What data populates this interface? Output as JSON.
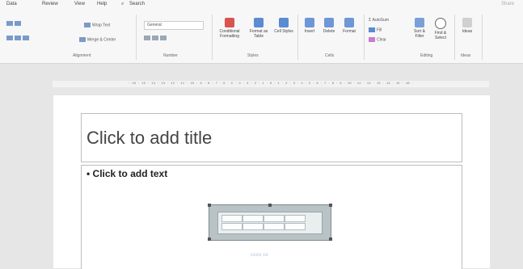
{
  "menubar": {
    "items": [
      "Data",
      "Review",
      "View",
      "Help",
      "Search"
    ],
    "share_label": "Share"
  },
  "ribbon": {
    "alignment": {
      "wrap_text": "Wrap Text",
      "merge_center": "Merge & Center",
      "label": "Alignment"
    },
    "number": {
      "format_value": "General",
      "label": "Number"
    },
    "styles": {
      "conditional_formatting": "Conditional Formatting",
      "format_as_table": "Format as Table",
      "cell_styles": "Cell Styles",
      "label": "Styles"
    },
    "cells": {
      "insert": "Insert",
      "delete": "Delete",
      "format": "Format",
      "label": "Cells"
    },
    "editing": {
      "autosum": "AutoSum",
      "fill": "Fill",
      "clear": "Clear",
      "sort_filter": "Sort & Filter",
      "find_select": "Find & Select",
      "label": "Editing"
    },
    "ideas": {
      "label": "Ideas",
      "button": "Ideas"
    }
  },
  "ruler": {
    "text": "· 16 · 15 · 14 · 13 · 12 · 11 · 10 · 9 · 8 · 7 · 6 · 5 · 4 · 3 · 2 · 1 · 0 · 1 · 2 · 3 · 4 · 5 · 6 · 7 · 8 · 9 · 10 · 11 · 12 · 13 · 14 · 15 · 16 ·"
  },
  "slide": {
    "title_placeholder": "Click to add title",
    "body_placeholder": "• Click to add text"
  },
  "colors": {
    "background": "#e6e6e6",
    "ribbon": "#f7f7f7",
    "slide": "#ffffff",
    "embed_frame": "#b9c3c6"
  }
}
